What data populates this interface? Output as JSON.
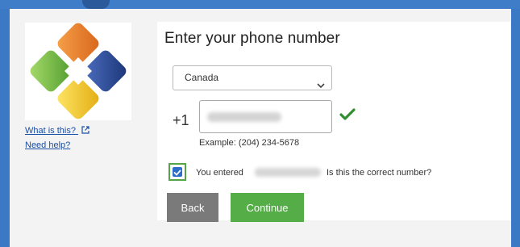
{
  "left": {
    "links": {
      "what_is_this": "What is this?",
      "need_help": "Need help?"
    }
  },
  "card": {
    "title": "Enter your phone number",
    "country_select": {
      "selected": "Canada"
    },
    "country_code": "+1",
    "example": "Example: (204) 234-5678",
    "confirm_prefix": "You entered",
    "confirm_suffix": "Is this the correct number?",
    "checkbox_checked": true,
    "buttons": {
      "back": "Back",
      "continue": "Continue"
    }
  },
  "colors": {
    "background_blue": "#3c79c4",
    "continue_green": "#55ad48",
    "back_gray": "#7a7a7a",
    "checkbox_blue": "#2d6ec9",
    "link_blue": "#1a4fa6",
    "valid_check_green": "#2f8f2f"
  },
  "icons": [
    "app-logo",
    "external-link-icon",
    "chevron-down-icon",
    "valid-check-icon",
    "checkbox-check-icon"
  ]
}
